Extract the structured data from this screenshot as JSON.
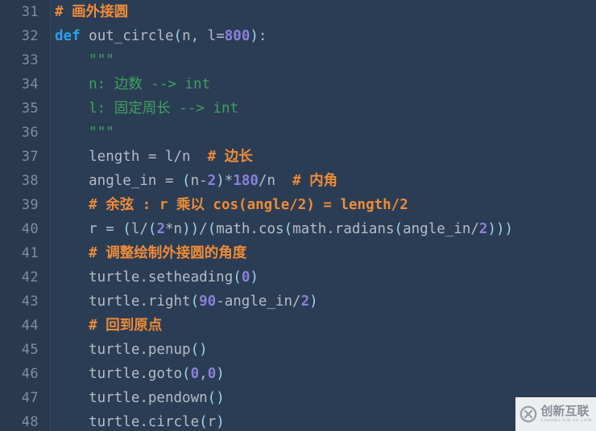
{
  "editor": {
    "language": "Python",
    "theme": "dark-slate-blue",
    "colors": {
      "background": "#2b3d54",
      "gutter_background": "#2a394d",
      "gutter_rule": "#364b63",
      "line_number": "#7d8fa3",
      "default_text": "#b3bdc8",
      "comment": "#ef8b38",
      "keyword": "#2e9fe8",
      "string": "#3fa05e",
      "number": "#8b7fdb",
      "bracket": "#9fd4e8"
    },
    "first_line_number": 31,
    "last_line_number": 48,
    "lines": [
      {
        "number": "31",
        "tokens": [
          {
            "text": "# 画外接圆",
            "type": "comment"
          }
        ]
      },
      {
        "number": "32",
        "tokens": [
          {
            "text": "def ",
            "type": "keyword"
          },
          {
            "text": "out_circle",
            "type": "plain"
          },
          {
            "text": "(",
            "type": "paren"
          },
          {
            "text": "n, l=",
            "type": "plain"
          },
          {
            "text": "800",
            "type": "number"
          },
          {
            "text": ")",
            "type": "paren"
          },
          {
            "text": ":",
            "type": "plain"
          }
        ]
      },
      {
        "number": "33",
        "tokens": [
          {
            "text": "    \"\"\"",
            "type": "string"
          }
        ]
      },
      {
        "number": "34",
        "tokens": [
          {
            "text": "    n: 边数 --> int",
            "type": "string"
          }
        ]
      },
      {
        "number": "35",
        "tokens": [
          {
            "text": "    l: 固定周长 --> int",
            "type": "string"
          }
        ]
      },
      {
        "number": "36",
        "tokens": [
          {
            "text": "    \"\"\"",
            "type": "string"
          }
        ]
      },
      {
        "number": "37",
        "tokens": [
          {
            "text": "    length = l/n  ",
            "type": "plain"
          },
          {
            "text": "# 边长",
            "type": "comment"
          }
        ]
      },
      {
        "number": "38",
        "tokens": [
          {
            "text": "    angle_in = ",
            "type": "plain"
          },
          {
            "text": "(",
            "type": "paren"
          },
          {
            "text": "n-",
            "type": "plain"
          },
          {
            "text": "2",
            "type": "number"
          },
          {
            "text": ")",
            "type": "paren"
          },
          {
            "text": "*",
            "type": "plain"
          },
          {
            "text": "180",
            "type": "number"
          },
          {
            "text": "/n  ",
            "type": "plain"
          },
          {
            "text": "# 内角",
            "type": "comment"
          }
        ]
      },
      {
        "number": "39",
        "tokens": [
          {
            "text": "    # 余弦 : r 乘以 cos(angle/2) = length/2",
            "type": "comment"
          }
        ]
      },
      {
        "number": "40",
        "tokens": [
          {
            "text": "    r = ",
            "type": "plain"
          },
          {
            "text": "(",
            "type": "paren"
          },
          {
            "text": "l/",
            "type": "plain"
          },
          {
            "text": "(",
            "type": "paren"
          },
          {
            "text": "2",
            "type": "number"
          },
          {
            "text": "*n",
            "type": "plain"
          },
          {
            "text": "))",
            "type": "paren"
          },
          {
            "text": "/",
            "type": "plain"
          },
          {
            "text": "(",
            "type": "paren"
          },
          {
            "text": "math.cos",
            "type": "plain"
          },
          {
            "text": "(",
            "type": "paren"
          },
          {
            "text": "math.radians",
            "type": "plain"
          },
          {
            "text": "(",
            "type": "paren"
          },
          {
            "text": "angle_in/",
            "type": "plain"
          },
          {
            "text": "2",
            "type": "number"
          },
          {
            "text": ")))",
            "type": "paren"
          }
        ]
      },
      {
        "number": "41",
        "tokens": [
          {
            "text": "    # 调整绘制外接圆的角度",
            "type": "comment"
          }
        ]
      },
      {
        "number": "42",
        "tokens": [
          {
            "text": "    turtle.setheading",
            "type": "plain"
          },
          {
            "text": "(",
            "type": "paren"
          },
          {
            "text": "0",
            "type": "number"
          },
          {
            "text": ")",
            "type": "paren"
          }
        ]
      },
      {
        "number": "43",
        "tokens": [
          {
            "text": "    turtle.right",
            "type": "plain"
          },
          {
            "text": "(",
            "type": "paren"
          },
          {
            "text": "90",
            "type": "number"
          },
          {
            "text": "-angle_in/",
            "type": "plain"
          },
          {
            "text": "2",
            "type": "number"
          },
          {
            "text": ")",
            "type": "paren"
          }
        ]
      },
      {
        "number": "44",
        "tokens": [
          {
            "text": "    # 回到原点",
            "type": "comment"
          }
        ]
      },
      {
        "number": "45",
        "tokens": [
          {
            "text": "    turtle.penup",
            "type": "plain"
          },
          {
            "text": "()",
            "type": "paren"
          }
        ]
      },
      {
        "number": "46",
        "tokens": [
          {
            "text": "    turtle.goto",
            "type": "plain"
          },
          {
            "text": "(",
            "type": "paren"
          },
          {
            "text": "0",
            "type": "number"
          },
          {
            "text": ",",
            "type": "plain"
          },
          {
            "text": "0",
            "type": "number"
          },
          {
            "text": ")",
            "type": "paren"
          }
        ]
      },
      {
        "number": "47",
        "tokens": [
          {
            "text": "    turtle.pendown",
            "type": "plain"
          },
          {
            "text": "()",
            "type": "paren"
          }
        ]
      },
      {
        "number": "48",
        "tokens": [
          {
            "text": "    turtle.circle",
            "type": "plain"
          },
          {
            "text": "(",
            "type": "paren"
          },
          {
            "text": "r",
            "type": "plain"
          },
          {
            "text": ")",
            "type": "paren"
          }
        ]
      }
    ]
  },
  "watermark": {
    "brand_cn": "创新互联",
    "brand_en": "CHUANG XIN HU LIAN",
    "logo_name": "circled-x-logo",
    "background": "#eceef0",
    "text_color": "#8a9099"
  }
}
